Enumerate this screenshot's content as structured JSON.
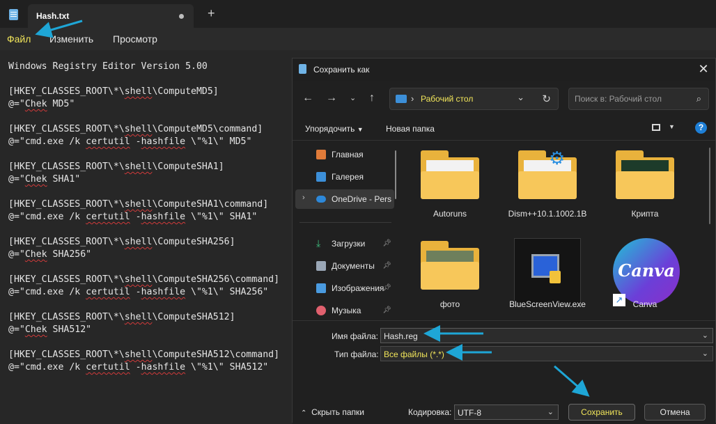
{
  "notepad": {
    "tab_title": "Hash.txt",
    "new_tab": "+",
    "menu": {
      "file": "Файл",
      "edit": "Изменить",
      "view": "Просмотр"
    },
    "lines": [
      "Windows Registry Editor Version 5.00",
      "",
      "[HKEY_CLASSES_ROOT\\*\\shell\\ComputeMD5]",
      "@=\"Chek MD5\"",
      "",
      "[HKEY_CLASSES_ROOT\\*\\shell\\ComputeMD5\\command]",
      "@=\"cmd.exe /k certutil -hashfile \\\"%1\\\" MD5\"",
      "",
      "[HKEY_CLASSES_ROOT\\*\\shell\\ComputeSHA1]",
      "@=\"Chek SHA1\"",
      "",
      "[HKEY_CLASSES_ROOT\\*\\shell\\ComputeSHA1\\command]",
      "@=\"cmd.exe /k certutil -hashfile \\\"%1\\\" SHA1\"",
      "",
      "[HKEY_CLASSES_ROOT\\*\\shell\\ComputeSHA256]",
      "@=\"Chek SHA256\"",
      "",
      "[HKEY_CLASSES_ROOT\\*\\shell\\ComputeSHA256\\command]",
      "@=\"cmd.exe /k certutil -hashfile \\\"%1\\\" SHA256\"",
      "",
      "[HKEY_CLASSES_ROOT\\*\\shell\\ComputeSHA512]",
      "@=\"Chek SHA512\"",
      "",
      "[HKEY_CLASSES_ROOT\\*\\shell\\ComputeSHA512\\command]",
      "@=\"cmd.exe /k certutil -hashfile \\\"%1\\\" SHA512\""
    ]
  },
  "dialog": {
    "title": "Сохранить как",
    "address": "Рабочий стол",
    "search_placeholder": "Поиск в: Рабочий стол",
    "toolbar": {
      "organize": "Упорядочить",
      "new_folder": "Новая папка",
      "help": "?"
    },
    "sidebar": [
      {
        "label": "Главная",
        "icon": "home-icon"
      },
      {
        "label": "Галерея",
        "icon": "gallery-icon"
      },
      {
        "label": "OneDrive - Personal",
        "icon": "onedrive-icon"
      },
      {
        "label": "Загрузки",
        "icon": "downloads-icon"
      },
      {
        "label": "Документы",
        "icon": "documents-icon"
      },
      {
        "label": "Изображения",
        "icon": "pictures-icon"
      },
      {
        "label": "Музыка",
        "icon": "music-icon"
      }
    ],
    "items": [
      {
        "label": "Autoruns",
        "icon": "folder-icon"
      },
      {
        "label": "Dism++10.1.1002.1B",
        "icon": "folder-gear-icon"
      },
      {
        "label": "Крипта",
        "icon": "folder-chart-icon"
      },
      {
        "label": "фото",
        "icon": "folder-photo-icon"
      },
      {
        "label": "BlueScreenView.exe",
        "icon": "bluescreenview-icon"
      },
      {
        "label": "Canva",
        "icon": "canva-shortcut-icon",
        "badge": "Canva"
      }
    ],
    "filename_label": "Имя файла:",
    "filename_value": "Hash.reg",
    "filetype_label": "Тип файла:",
    "filetype_value": "Все файлы  (*.*)",
    "encoding_label": "Кодировка:",
    "encoding_value": "UTF-8",
    "save_label": "Сохранить",
    "cancel_label": "Отмена",
    "hide_folders_label": "Скрыть папки"
  },
  "colors": {
    "accent_yellow": "#f1e55a",
    "annotation_arrow": "#1ea6d6",
    "folder": "#f7c75a"
  }
}
